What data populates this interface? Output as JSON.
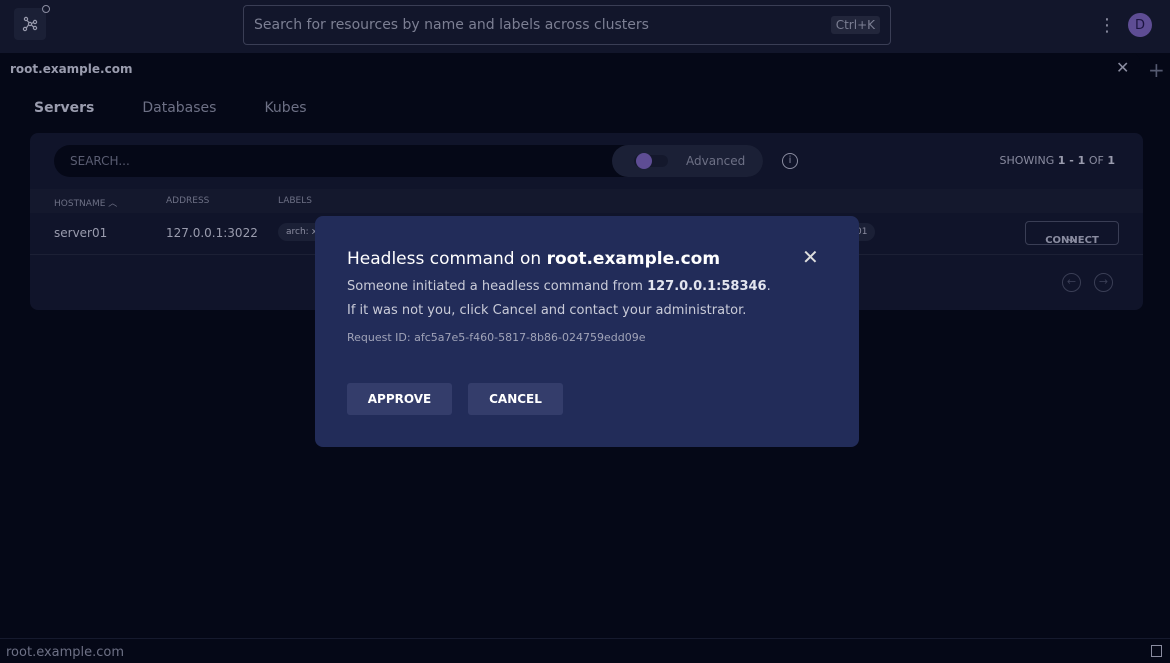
{
  "header": {
    "search_placeholder": "Search for resources by name and labels across clusters",
    "shortcut": "Ctrl+K",
    "avatar_initial": "D"
  },
  "tab": {
    "title": "root.example.com"
  },
  "nav": {
    "tabs": [
      {
        "label": "Servers",
        "active": true
      },
      {
        "label": "Databases"
      },
      {
        "label": "Kubes"
      }
    ]
  },
  "table": {
    "search_placeholder": "SEARCH...",
    "advanced_label": "Advanced",
    "showing_prefix": "SHOWING",
    "range": "1 - 1",
    "of": "OF",
    "total": "1",
    "columns": [
      "HOSTNAME",
      "ADDRESS",
      "LABELS"
    ],
    "rows": [
      {
        "hostname": "server01",
        "address": "127.0.0.1:3022",
        "label_first": "arch: x",
        "label_last": "01",
        "action": "CONNECT"
      }
    ]
  },
  "modal": {
    "title_prefix": "Headless command on",
    "title_cluster": "root.example.com",
    "line1_prefix": "Someone initiated a headless command from",
    "line1_addr": "127.0.0.1:58346",
    "line1_suffix": ".",
    "line2": "If it was not you, click Cancel and contact your administrator.",
    "request_id": "Request ID: afc5a7e5-f460-5817-8b86-024759edd09e",
    "approve": "APPROVE",
    "cancel": "CANCEL"
  },
  "status_bar": {
    "text": "root.example.com"
  },
  "colors": {
    "accent": "#5e4d94",
    "modal_bg": "#222c59",
    "button_bg": "#343d6b"
  }
}
